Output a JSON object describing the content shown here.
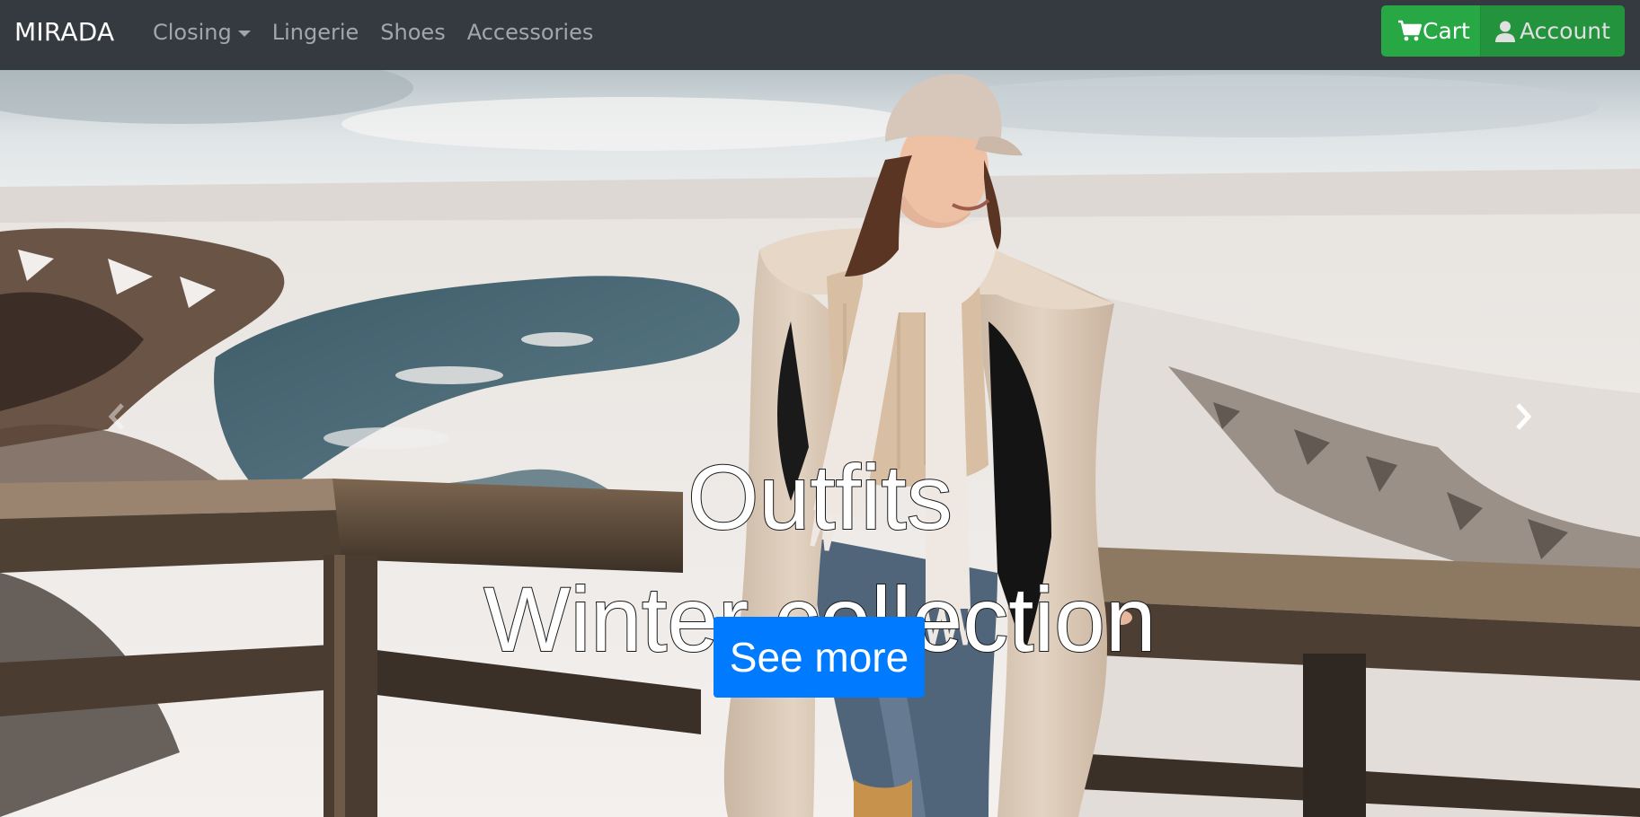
{
  "navbar": {
    "brand": "MIRADA",
    "links": [
      {
        "label": "Closing",
        "dropdown": true
      },
      {
        "label": "Lingerie"
      },
      {
        "label": "Shoes"
      },
      {
        "label": "Accessories"
      }
    ],
    "cart_label": "Cart",
    "account_label": "Account",
    "cart_icon": "shopping-cart-icon",
    "account_icon": "user-icon",
    "background_color": "#343a40",
    "button_color": "#28a745"
  },
  "hero": {
    "caption_line1": "Outfits",
    "caption_line2": "Winter collection",
    "cta_label": "See more",
    "cta_color": "#007bff",
    "prev_icon": "chevron-left-icon",
    "next_icon": "chevron-right-icon"
  }
}
